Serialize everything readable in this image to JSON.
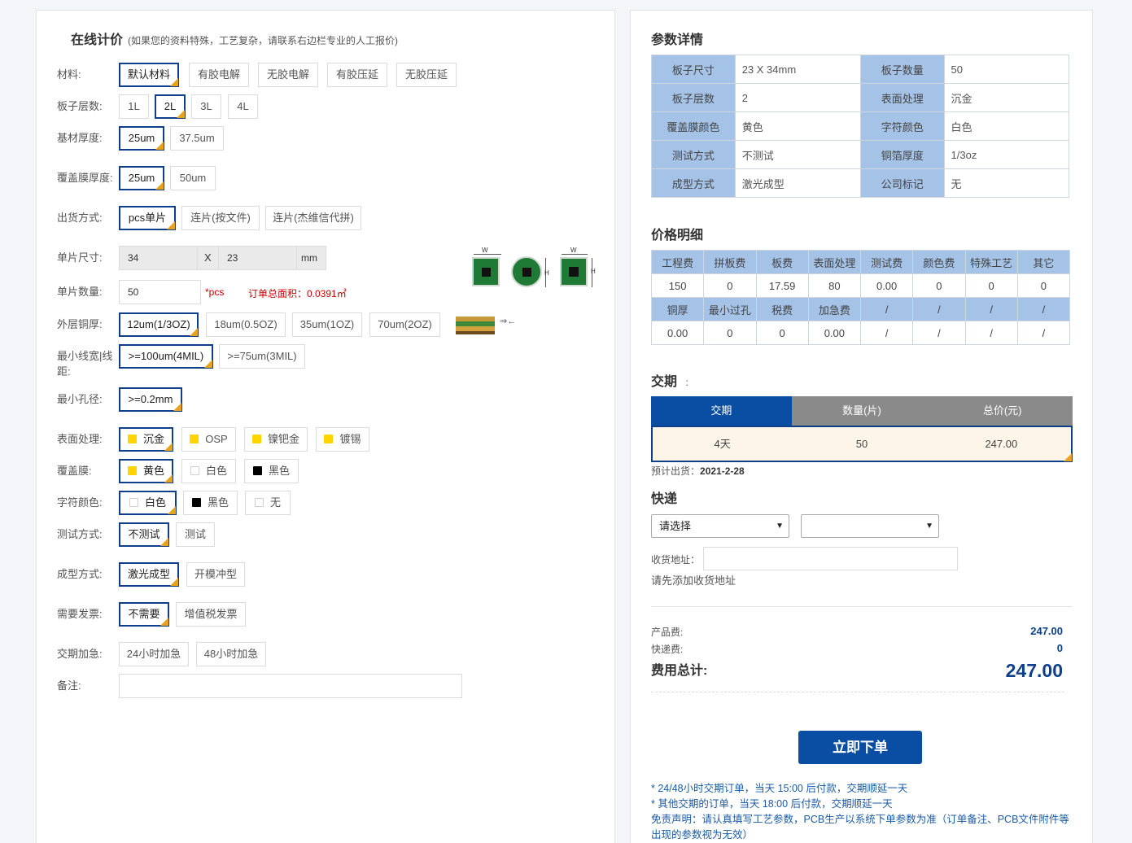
{
  "left": {
    "title": "在线计价",
    "title_note": "(如果您的资料特殊，工艺复杂，请联系右边栏专业的人工报价)",
    "material": {
      "label": "材料:",
      "options": [
        "默认材料",
        "有胶电解",
        "无胶电解",
        "有胶压延",
        "无胶压延"
      ]
    },
    "layers": {
      "label": "板子层数:",
      "options": [
        "1L",
        "2L",
        "3L",
        "4L"
      ]
    },
    "base_thickness": {
      "label": "基材厚度:",
      "options": [
        "25um",
        "37.5um"
      ]
    },
    "cover_thickness": {
      "label": "覆盖膜厚度:",
      "options": [
        "25um",
        "50um"
      ]
    },
    "shipping_mode": {
      "label": "出货方式:",
      "options": [
        "pcs单片",
        "连片(按文件)",
        "连片(杰维信代拼)"
      ]
    },
    "size": {
      "label": "单片尺寸:",
      "width": "34",
      "x": "X",
      "height": "23",
      "unit": "mm"
    },
    "quantity": {
      "label": "单片数量:",
      "value": "50",
      "unit": "*pcs",
      "area": "订单总面积：0.0391㎡"
    },
    "copper": {
      "label": "外层铜厚:",
      "options": [
        "12um(1/3OZ)",
        "18um(0.5OZ)",
        "35um(1OZ)",
        "70um(2OZ)"
      ]
    },
    "min_trace": {
      "label": "最小线宽|线距:",
      "options": [
        ">=100um(4MIL)",
        ">=75um(3MIL)"
      ]
    },
    "min_hole": {
      "label": "最小孔径:",
      "options": [
        ">=0.2mm"
      ]
    },
    "surface": {
      "label": "表面处理:",
      "options": [
        "沉金",
        "OSP",
        "镍钯金",
        "镀锡"
      ]
    },
    "coverlay": {
      "label": "覆盖膜:",
      "options": [
        "黄色",
        "白色",
        "黑色"
      ]
    },
    "silkscreen": {
      "label": "字符颜色:",
      "options": [
        "白色",
        "黑色",
        "无"
      ]
    },
    "test": {
      "label": "测试方式:",
      "options": [
        "不测试",
        "测试"
      ]
    },
    "forming": {
      "label": "成型方式:",
      "options": [
        "激光成型",
        "开模冲型"
      ]
    },
    "invoice": {
      "label": "需要发票:",
      "options": [
        "不需要",
        "增值税发票"
      ]
    },
    "urgent": {
      "label": "交期加急:",
      "options": [
        "24小时加急",
        "48小时加急"
      ]
    },
    "remark": {
      "label": "备注:"
    },
    "diagram": {
      "w": "W",
      "h": "H",
      "arrow": "⇒←"
    }
  },
  "right": {
    "params_title": "参数详情",
    "params": [
      [
        "板子尺寸",
        "23 X 34mm",
        "板子数量",
        "50"
      ],
      [
        "板子层数",
        "2",
        "表面处理",
        "沉金"
      ],
      [
        "覆盖膜颜色",
        "黄色",
        "字符颜色",
        "白色"
      ],
      [
        "测试方式",
        "不测试",
        "铜箔厚度",
        "1/3oz"
      ],
      [
        "成型方式",
        "激光成型",
        "公司标记",
        "无"
      ]
    ],
    "price_title": "价格明细",
    "price_head1": [
      "工程费",
      "拼板费",
      "板费",
      "表面处理",
      "测试费",
      "颜色费",
      "特殊工艺",
      "其它"
    ],
    "price_row1": [
      "150",
      "0",
      "17.59",
      "80",
      "0.00",
      "0",
      "0",
      "0"
    ],
    "price_head2": [
      "铜厚",
      "最小过孔",
      "税费",
      "加急费",
      "/",
      "/",
      "/",
      "/"
    ],
    "price_row2": [
      "0.00",
      "0",
      "0",
      "0.00",
      "/",
      "/",
      "/",
      "/"
    ],
    "delivery_title": "交期",
    "delivery_colon": ":",
    "delivery_head": [
      "交期",
      "数量(片)",
      "总价(元)"
    ],
    "delivery_row": [
      "4天",
      "50",
      "247.00"
    ],
    "eta_label": "预计出货：",
    "eta_value": "2021-2-28",
    "express_title": "快递",
    "express_select1": "请选择",
    "express_select2": "",
    "address_label": "收货地址：",
    "address_hint": "请先添加收货地址",
    "product_fee_label": "产品费:",
    "product_fee": "247.00",
    "express_fee_label": "快递费:",
    "express_fee": "0",
    "total_label": "费用总计:",
    "total": "247.00",
    "order_button": "立即下单",
    "notes": [
      "* 24/48小时交期订单，当天 15:00 后付款，交期顺延一天",
      "* 其他交期的订单，当天 18:00 后付款，交期顺延一天",
      "免责声明：请认真填写工艺参数，PCB生产以系统下单参数为准（订单备注、PCB文件附件等出现的参数视为无效）"
    ]
  }
}
